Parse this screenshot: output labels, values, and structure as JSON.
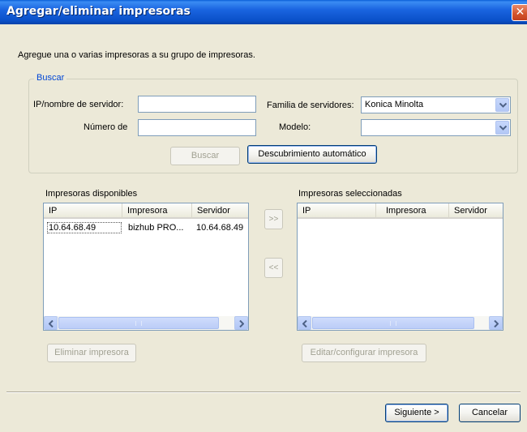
{
  "window": {
    "title": "Agregar/eliminar impresoras",
    "close": "✕"
  },
  "intro": "Agregue una o varias impresoras a su grupo de impresoras.",
  "search": {
    "group_title": "Buscar",
    "ip_label": "IP/nombre de servidor:",
    "ip_value": "",
    "number_label": "Número de",
    "number_value": "",
    "family_label": "Familia de servidores:",
    "family_value": "Konica Minolta",
    "model_label": "Modelo:",
    "model_value": "",
    "search_button": "Buscar",
    "discover_button": "Descubrimiento automático"
  },
  "available": {
    "title": "Impresoras disponibles",
    "columns": [
      "IP",
      "Impresora",
      "Servidor"
    ],
    "rows": [
      {
        "ip": "10.64.68.49",
        "printer": "bizhub PRO...",
        "server": "10.64.68.49"
      }
    ],
    "remove_button": "Eliminar impresora"
  },
  "transfer": {
    "add": ">>",
    "remove": "<<"
  },
  "selected": {
    "title": "Impresoras seleccionadas",
    "columns": [
      "IP",
      "Impresora",
      "Servidor"
    ],
    "edit_button": "Editar/configurar impresora"
  },
  "footer": {
    "next_button": "Siguiente >",
    "cancel_button": "Cancelar"
  }
}
